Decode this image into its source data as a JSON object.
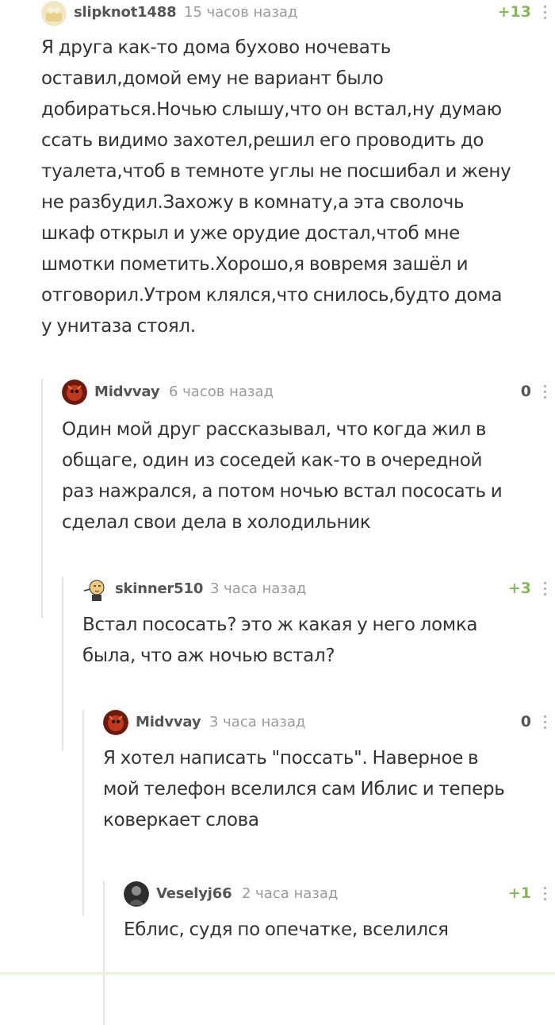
{
  "comments": [
    {
      "author": "slipknot1488",
      "time": "15 часов назад",
      "rating": "+13",
      "lines": [
        "Я друга как-то дома бухово ночевать",
        "оставил,домой ему не вариант было",
        "добираться.Ночью слышу,что он встал,ну думаю",
        "ссать видимо захотел,решил его проводить до",
        "туалета,чтоб в темноте углы не посшибал и жену",
        "не разбудил.Захожу в комнату,а эта сволочь",
        "шкаф открыл и уже орудие достал,чтоб мне",
        "шмотки пометить.Хорошо,я вовремя зашёл и",
        "отговорил.Утром клялся,что снилось,будто дома",
        "у унитаза стоял."
      ]
    },
    {
      "author": "Midvvay",
      "time": "6 часов назад",
      "rating": "0",
      "lines": [
        "Один мой друг рассказывал, что когда жил в",
        "общаге, один из соседей как-то в очередной",
        "раз нажрался, а потом ночью встал пососать и",
        "сделал свои дела в холодильник"
      ]
    },
    {
      "author": "skinner510",
      "time": "3 часа назад",
      "rating": "+3",
      "lines": [
        "Встал пососать? это ж какая у него ломка",
        "была, что аж ночью встал?"
      ]
    },
    {
      "author": "Midvvay",
      "time": "3 часа назад",
      "rating": "0",
      "lines": [
        "Я хотел написать \"поссать\". Наверное в",
        "мой телефон вселился сам Иблис и теперь",
        "коверкает слова"
      ]
    },
    {
      "author": "Veselyj66",
      "time": "2 часа назад",
      "rating": "+1",
      "lines": [
        "Еблис, судя по опечатке, вселился"
      ]
    }
  ],
  "colors": {
    "positive_rating": "#8ab55c",
    "neutral_rating": "#555555",
    "thread_line": "#e3e3e3"
  },
  "icons": {
    "more": "more-vertical-icon"
  }
}
